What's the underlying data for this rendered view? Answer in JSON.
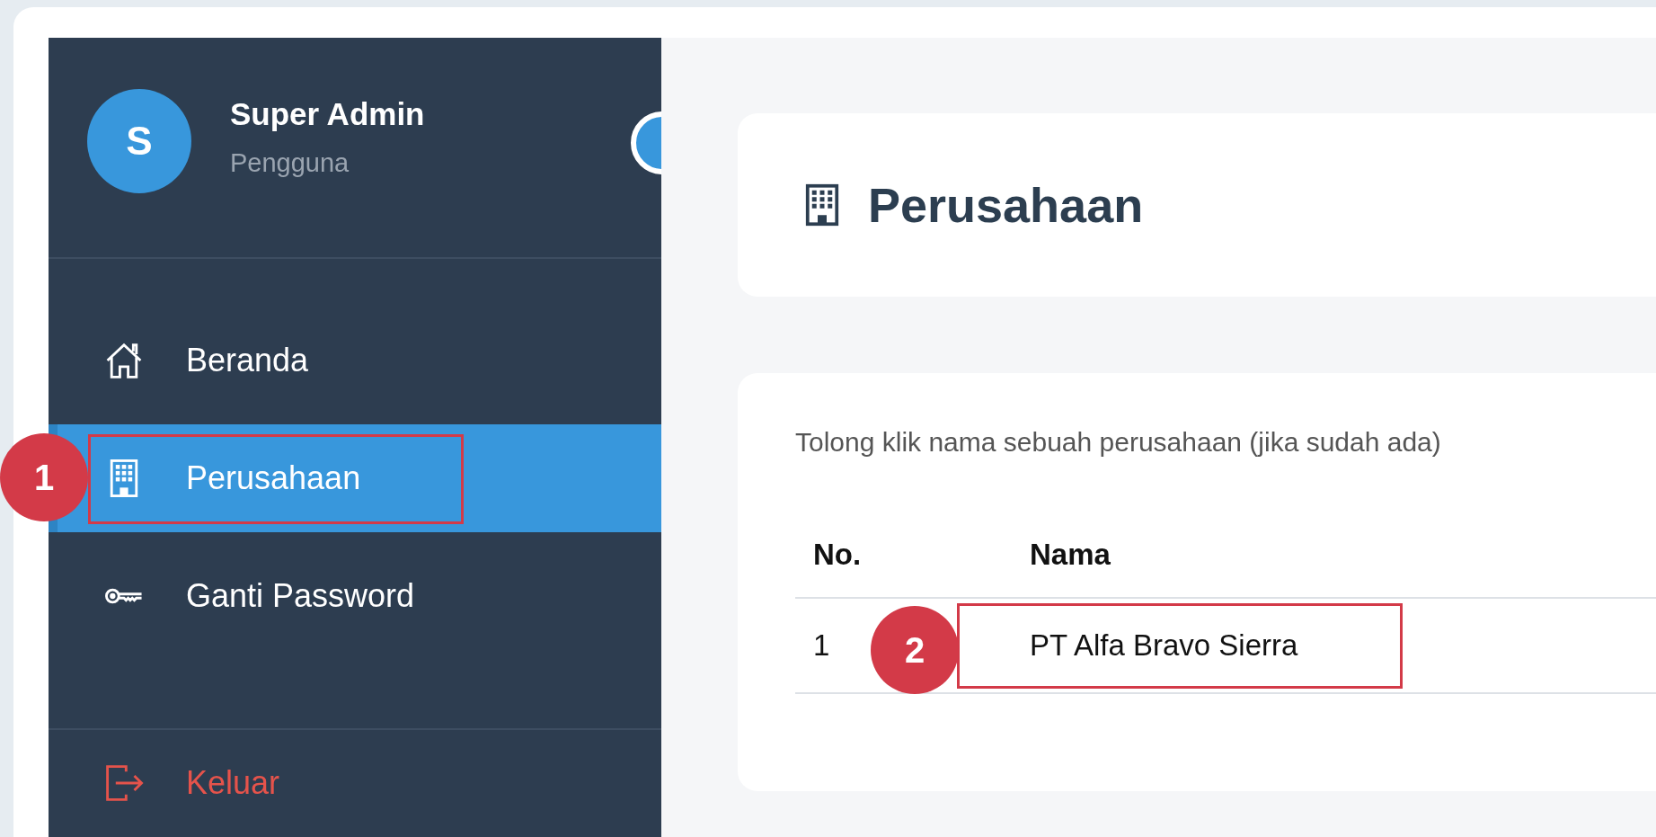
{
  "user": {
    "initial": "S",
    "name": "Super Admin",
    "role": "Pengguna"
  },
  "menu": [
    {
      "label": "Beranda",
      "kind": "home",
      "selected": false
    },
    {
      "label": "Perusahaan",
      "kind": "company",
      "selected": true
    },
    {
      "label": "Ganti Password",
      "kind": "key",
      "selected": false
    }
  ],
  "logout": {
    "label": "Keluar"
  },
  "page": {
    "title": "Perusahaan"
  },
  "instruction": "Tolong klik nama sebuah perusahaan (jika sudah ada)",
  "table": {
    "columns": [
      "No.",
      "Nama"
    ],
    "rows": [
      {
        "no": "1",
        "name": "PT Alfa Bravo Sierra"
      }
    ]
  },
  "annotations": [
    {
      "label": "1"
    },
    {
      "label": "2"
    }
  ]
}
